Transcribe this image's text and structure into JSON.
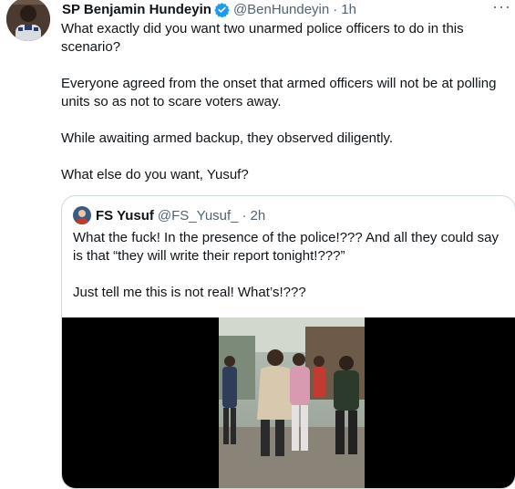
{
  "tweet": {
    "author_name": "SP Benjamin Hundeyin",
    "author_handle": "@BenHundeyin",
    "separator": "·",
    "time": "1h",
    "more_label": "···",
    "paragraphs": [
      "What exactly did you want two unarmed police officers to do in this scenario?",
      "Everyone agreed from the onset that armed officers will not be at polling units so as not to scare voters away.",
      "While awaiting armed backup, they observed diligently.",
      "What else do you want, Yusuf?"
    ]
  },
  "quoted": {
    "author_name": "FS Yusuf",
    "author_handle": "@FS_Yusuf_",
    "separator": "·",
    "time": "2h",
    "paragraphs": [
      "What the fuck! In the presence of the police!??? And all they could say is that “they will write their report tonight!???”",
      "Just tell me this is not real! What’s!???"
    ]
  },
  "colors": {
    "verified": "#1d9bf0",
    "secondary_text": "#536471",
    "border": "#cfd9de",
    "text": "#0f1419"
  }
}
